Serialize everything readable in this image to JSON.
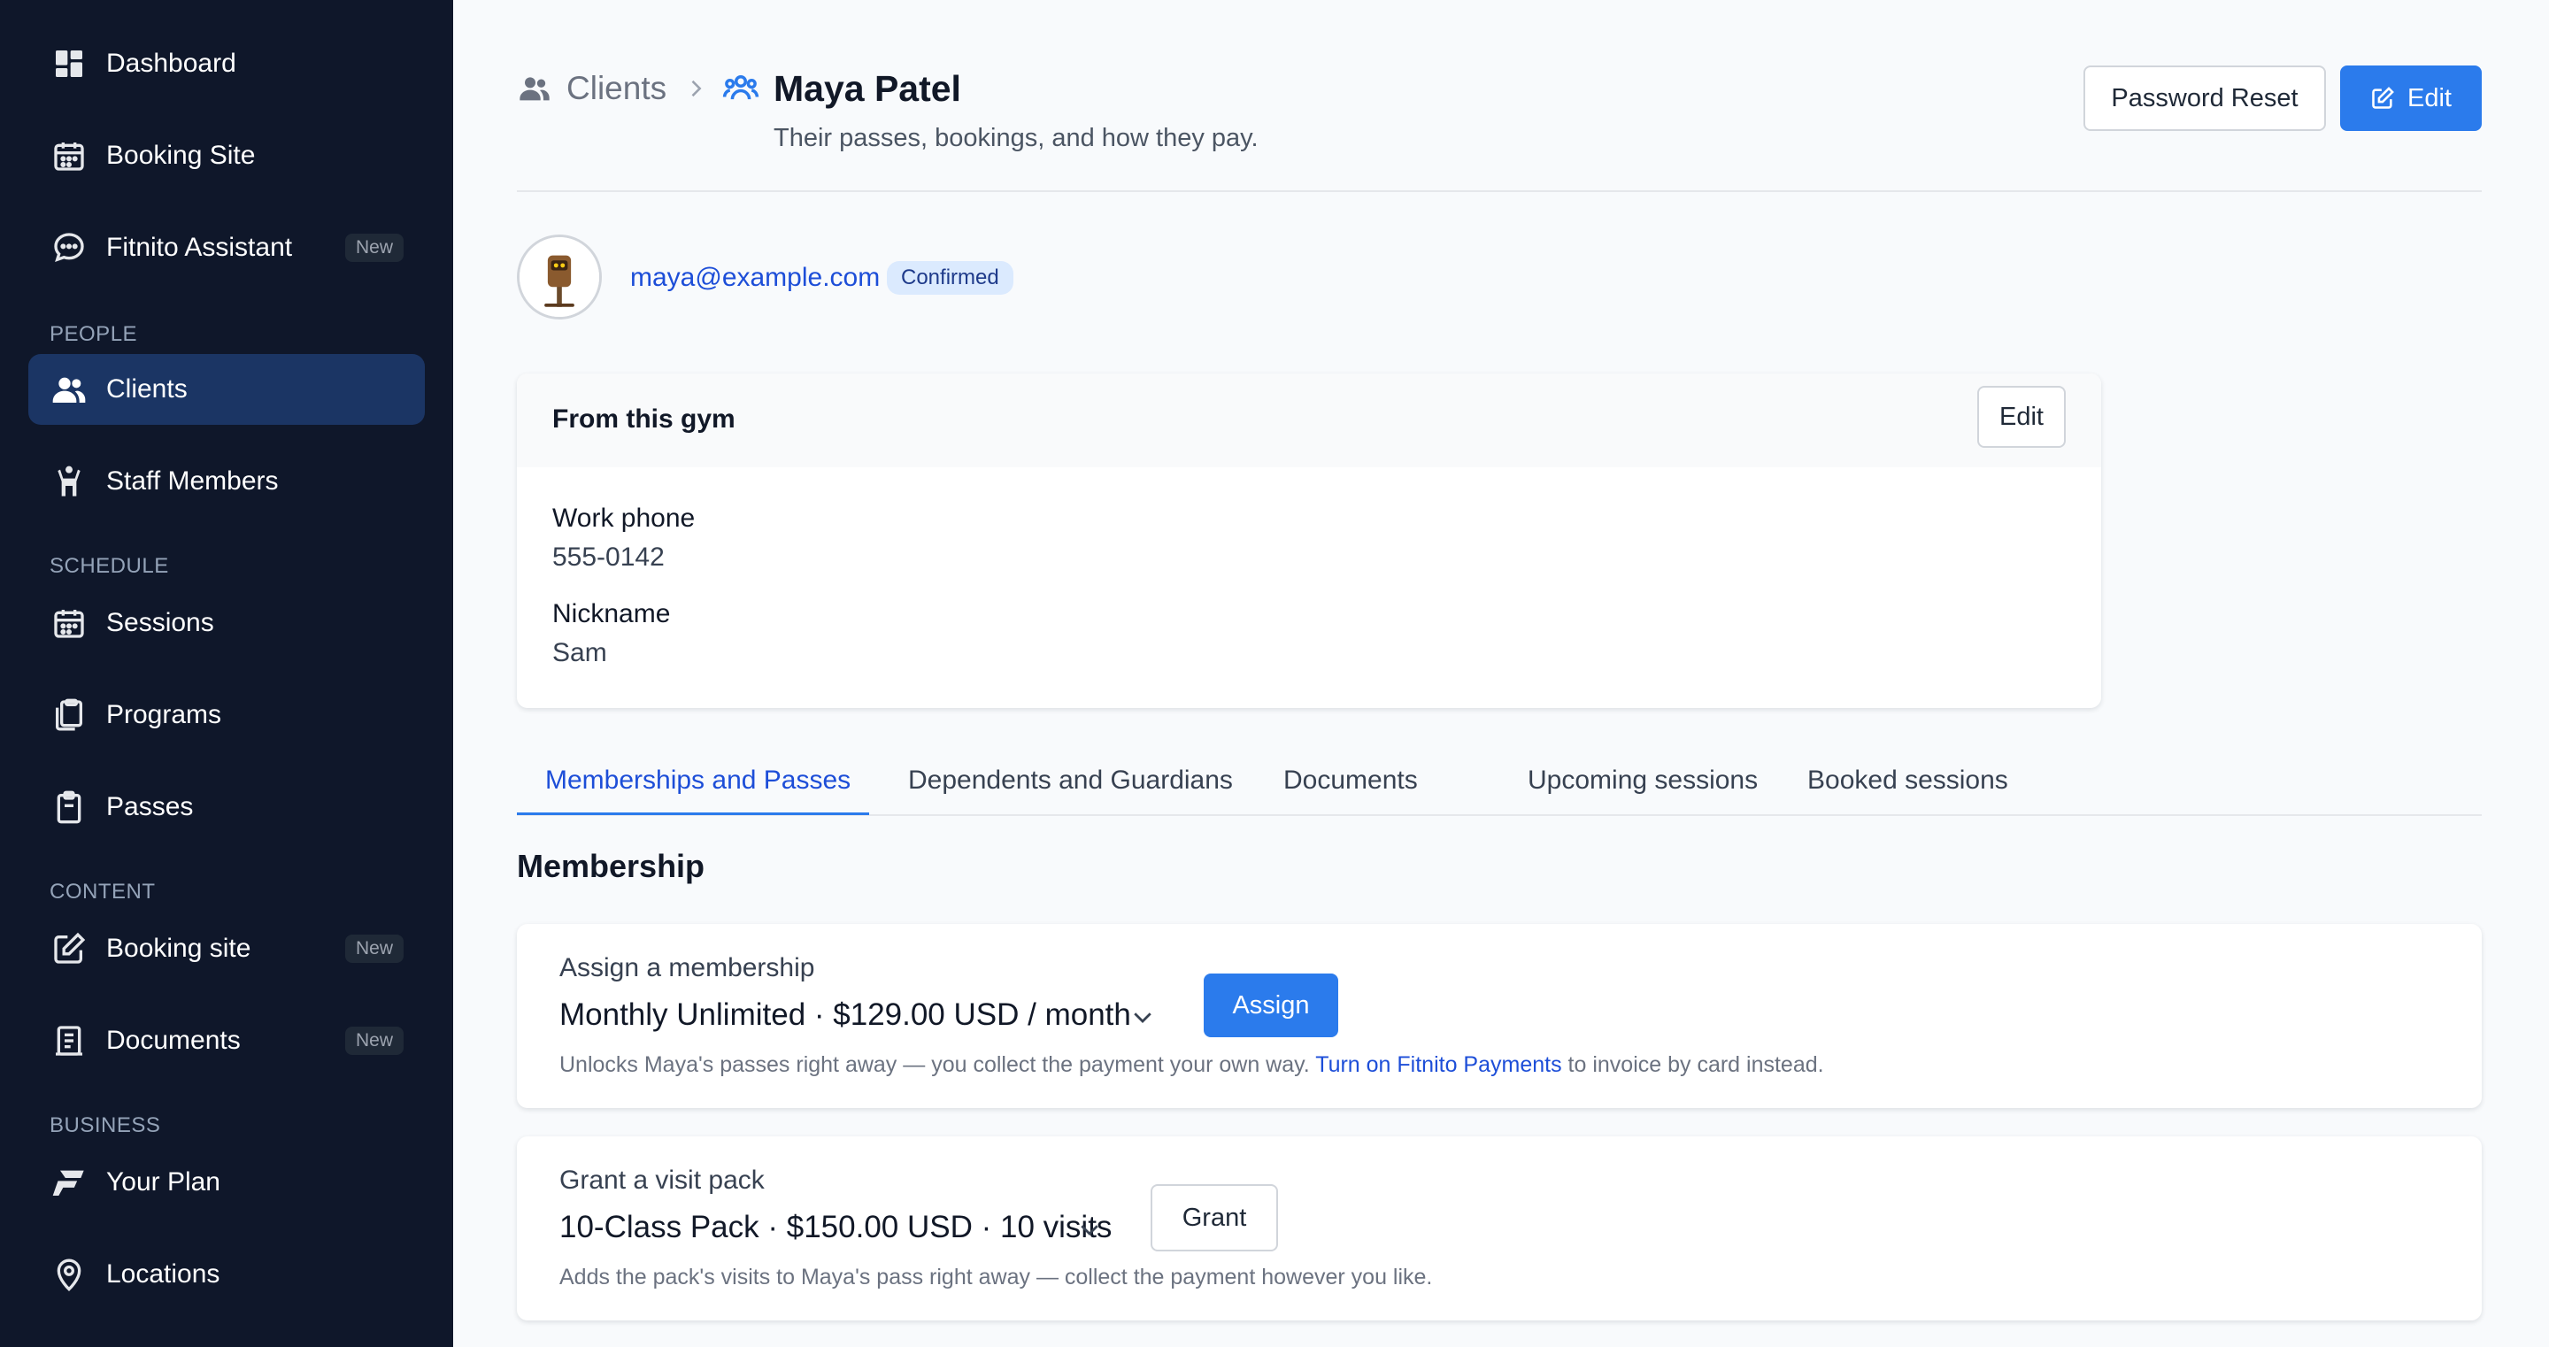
{
  "sidebar": {
    "items": [
      {
        "label": "Dashboard",
        "icon": "dashboard-icon"
      },
      {
        "label": "Booking Site",
        "icon": "calendar-icon"
      },
      {
        "label": "Fitnito Assistant",
        "icon": "chat-icon",
        "badge": "New"
      },
      {
        "label": "Clients",
        "icon": "users-icon",
        "active": true
      },
      {
        "label": "Staff Members",
        "icon": "person-icon"
      },
      {
        "label": "Sessions",
        "icon": "calendar-icon"
      },
      {
        "label": "Programs",
        "icon": "clipboard-icon"
      },
      {
        "label": "Passes",
        "icon": "clipboard-list-icon"
      },
      {
        "label": "Booking site",
        "icon": "edit-icon",
        "badge": "New"
      },
      {
        "label": "Documents",
        "icon": "document-icon",
        "badge": "New"
      },
      {
        "label": "Your Plan",
        "icon": "brand-logo-icon"
      },
      {
        "label": "Locations",
        "icon": "map-pin-icon"
      }
    ],
    "sections": {
      "people": "PEOPLE",
      "schedule": "SCHEDULE",
      "content": "CONTENT",
      "business": "BUSINESS"
    }
  },
  "header": {
    "breadcrumb_parent": "Clients",
    "title": "Maya Patel",
    "subtitle": "Their passes, bookings, and how they pay.",
    "password_reset_label": "Password Reset",
    "edit_label": "Edit"
  },
  "profile": {
    "email": "maya@example.com",
    "status": "Confirmed"
  },
  "gym_card": {
    "title": "From this gym",
    "edit_label": "Edit",
    "fields": [
      {
        "label": "Work phone",
        "value": "555-0142"
      },
      {
        "label": "Nickname",
        "value": "Sam"
      }
    ]
  },
  "tabs": [
    {
      "label": "Memberships and Passes",
      "active": true
    },
    {
      "label": "Dependents and Guardians"
    },
    {
      "label": "Documents"
    },
    {
      "label": "Upcoming sessions"
    },
    {
      "label": "Booked sessions"
    }
  ],
  "membership": {
    "heading": "Membership",
    "assign": {
      "label": "Assign a membership",
      "selected": "Monthly Unlimited · $129.00 USD / month",
      "button": "Assign",
      "help_before": "Unlocks Maya's passes right away — you collect the payment your own way. ",
      "help_link": "Turn on Fitnito Payments",
      "help_after": " to invoice by card instead."
    },
    "grant": {
      "label": "Grant a visit pack",
      "selected": "10-Class Pack · $150.00 USD · 10 visits",
      "button": "Grant",
      "help": "Adds the pack's visits to Maya's pass right away — collect the payment however you like."
    }
  },
  "colors": {
    "sidebar_bg": "#0f172a",
    "sidebar_active": "#1b3564",
    "primary": "#2b7bec",
    "link": "#1d4ed8"
  }
}
